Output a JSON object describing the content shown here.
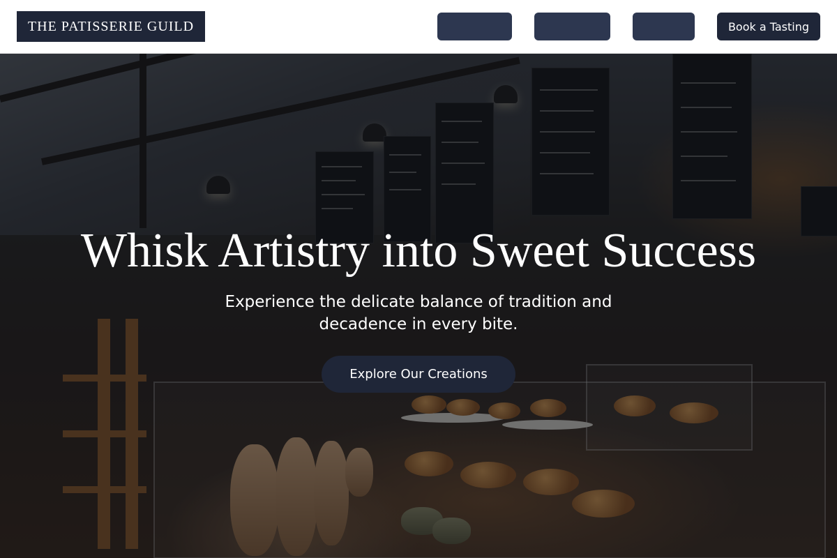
{
  "header": {
    "logo_text": "THE PATISSERIE GUILD",
    "nav_items": [
      "",
      "",
      ""
    ],
    "cta_label": "Book a Tasting"
  },
  "hero": {
    "title": "Whisk Artistry into Sweet Success",
    "subtitle": "Experience the delicate balance of tradition and decadence in every bite.",
    "button_label": "Explore Our Creations"
  },
  "colors": {
    "navy": "#1f2638",
    "nav_button": "#2d3750",
    "header_bg": "#ffffff",
    "hero_text": "#ffffff"
  }
}
